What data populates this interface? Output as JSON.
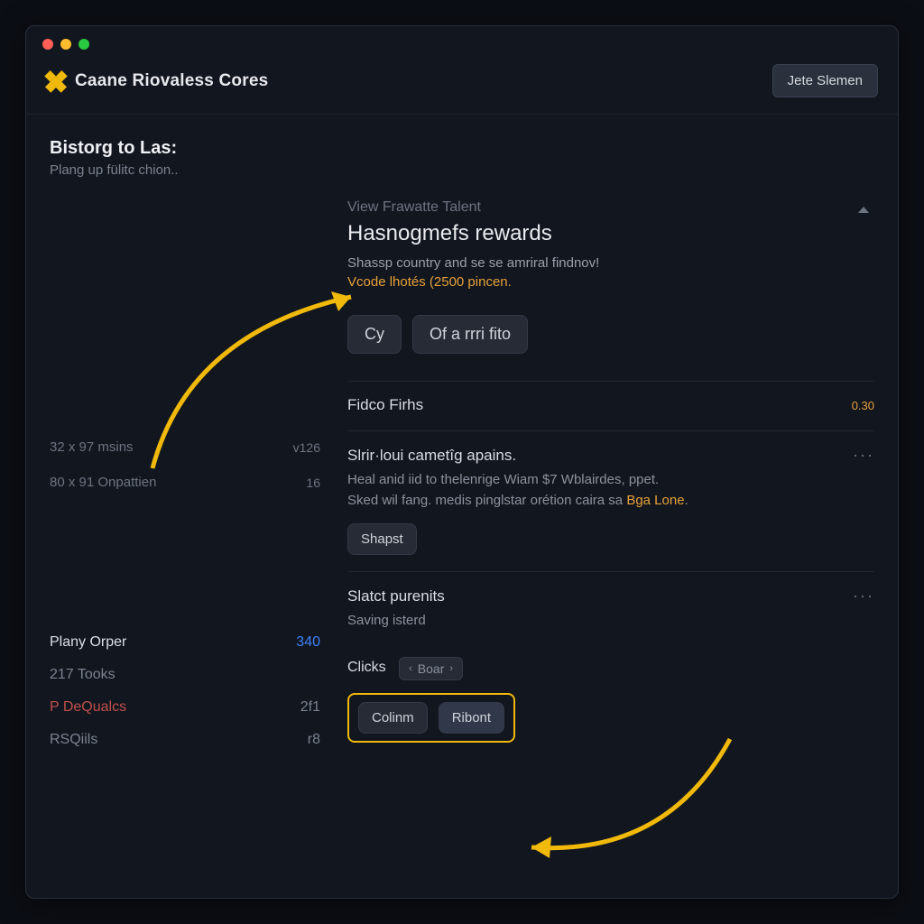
{
  "colors": {
    "accent": "#f0b90b",
    "warn": "#e7a13a",
    "link": "#3b82f6",
    "danger": "#c0504d"
  },
  "window": {
    "brand_title": "Caane Riovaless Cores",
    "header_button": "Jete Slemen"
  },
  "left": {
    "section_title": "Bistorg to Las:",
    "section_sub": "Plang up fülitc chion..",
    "stats": [
      {
        "label": "32 x 97 msins",
        "value": "v126"
      },
      {
        "label": "80 x 91 Onpattien",
        "value": "16"
      }
    ],
    "orders": [
      {
        "label": "Plany Orper",
        "value": "340",
        "variant": "blue"
      },
      {
        "label": "217 Tooks",
        "value": "",
        "variant": "muted"
      },
      {
        "label": "P DeQualcs",
        "value": "2f1",
        "variant": "red"
      },
      {
        "label": "RSQiils",
        "value": "r8",
        "variant": "muted"
      }
    ]
  },
  "main": {
    "eyebrow": "View Frawatte Talent",
    "title": "Hasnogmefs rewards",
    "sub1": "Shassp country and se se amriral findnov!",
    "sub2": "Vcode lhotés (2500 pincen.",
    "buttons": {
      "cy": "Cy",
      "of": "Of a rrri fito"
    },
    "items": [
      {
        "title": "Fidco Firhs",
        "badge": "0.30",
        "body_lines": [],
        "actions": []
      },
      {
        "title": "Slrir·loui cametîg apains.",
        "body1": "Heal anid iid to thelenrige Wiam $7 Wblairdes, ppet.",
        "body2_a": "Sked wil fang. medis pinglstar orétion caira sa ",
        "body2_hl": "Bga Lone",
        "body2_b": ".",
        "action": "Shapst",
        "more": "···"
      },
      {
        "title": "Slatct purenits",
        "sub": "Saving isterd",
        "more": "···"
      }
    ],
    "clicks": {
      "label": "Clicks",
      "pill": "Boar",
      "buttons": {
        "confirm": "Colinm",
        "ribont": "Ribont"
      }
    }
  }
}
